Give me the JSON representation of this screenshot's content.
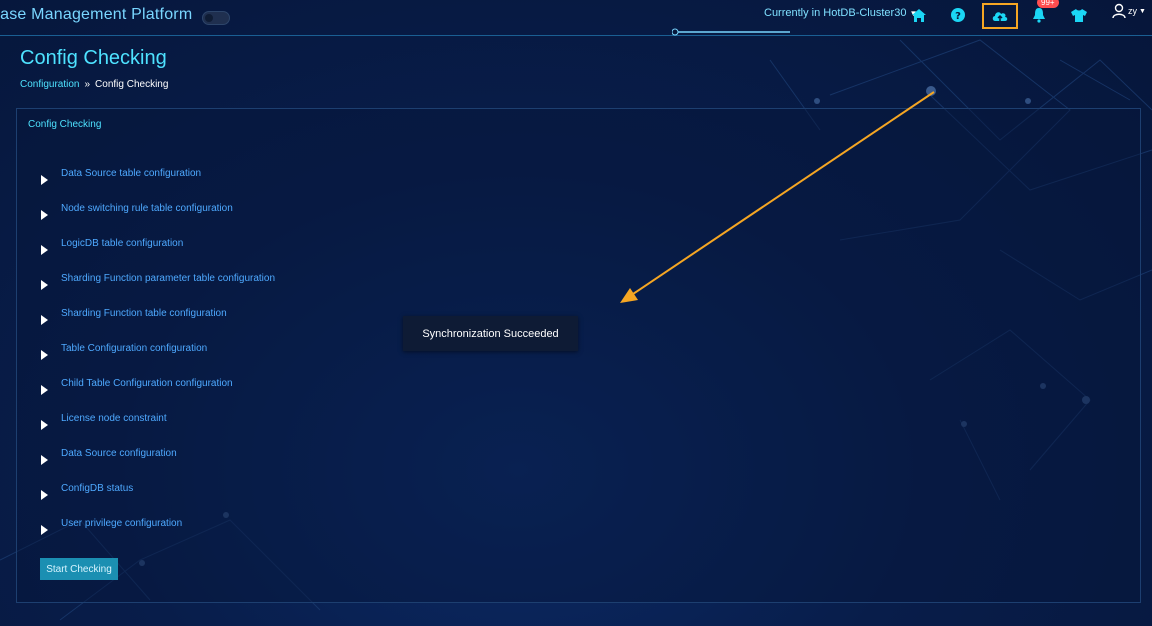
{
  "header": {
    "app_title": "base Management Platform",
    "cluster_label": "Currently in HotDB-Cluster30",
    "notifications_badge": "99+",
    "username": "zy"
  },
  "page": {
    "title": "Config Checking",
    "breadcrumb": {
      "parent": "Configuration",
      "separator": "»",
      "current": "Config Checking"
    }
  },
  "panel": {
    "title": "Config Checking",
    "items": [
      {
        "label": "Data Source table configuration"
      },
      {
        "label": "Node switching rule table configuration"
      },
      {
        "label": "LogicDB table configuration"
      },
      {
        "label": "Sharding Function parameter table configuration"
      },
      {
        "label": "Sharding Function table configuration"
      },
      {
        "label": "Table Configuration configuration"
      },
      {
        "label": "Child Table Configuration configuration"
      },
      {
        "label": "License node constraint"
      },
      {
        "label": "Data Source configuration"
      },
      {
        "label": "ConfigDB status"
      },
      {
        "label": "User privilege configuration"
      }
    ],
    "start_button": "Start Checking"
  },
  "toast": {
    "message": "Synchronization Succeeded"
  },
  "icons": [
    "home-icon",
    "help-icon",
    "cloud-sync-icon",
    "bell-icon",
    "shirt-icon",
    "user-icon"
  ],
  "colors": {
    "accent": "#4ee2ff",
    "highlight": "#f5a623",
    "badge": "#ff4d4f",
    "button": "#1b8fb2"
  }
}
